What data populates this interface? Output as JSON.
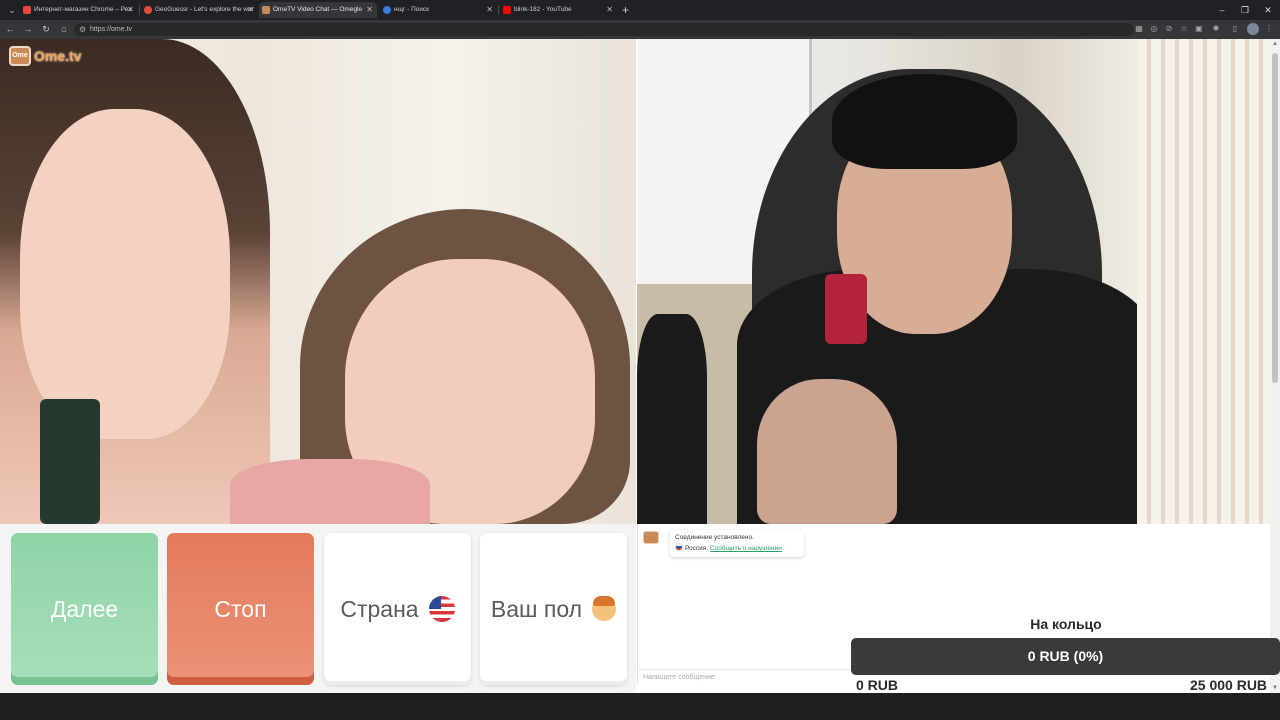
{
  "browser": {
    "tabs": [
      {
        "title": "Интернет-магазин Chrome – Рез",
        "favicon_color": "#e8453c"
      },
      {
        "title": "GeoGuessr - Let's explore the wor",
        "favicon_color": "#e64a3a"
      },
      {
        "title": "OmeTV Video Chat — Omegle",
        "favicon_color": "#c98a5a",
        "active": true
      },
      {
        "title": "нщг - Поиск",
        "favicon_color": "#3b7bde"
      },
      {
        "title": "blink-182 - YouTube",
        "favicon_color": "#ff0000"
      }
    ],
    "url": "https://ome.tv"
  },
  "site": {
    "logo_text": "Ome.tv",
    "logo_badge": "Ome"
  },
  "controls": {
    "next_label": "Далее",
    "stop_label": "Стоп",
    "country_label": "Страна",
    "gender_label": "Ваш пол"
  },
  "chat": {
    "status_message": "Соединение установлено.",
    "country": "Россия.",
    "report_link": "Сообщить о нарушении",
    "input_placeholder": "Напишите сообщение"
  },
  "donation": {
    "title": "На кольцо",
    "progress_text": "0 RUB (0%)",
    "progress": 0,
    "min_label": "0 RUB",
    "max_label": "25 000 RUB"
  },
  "colors": {
    "next": "#8fd3a7",
    "stop": "#e47a5c",
    "link": "#27a36b"
  }
}
